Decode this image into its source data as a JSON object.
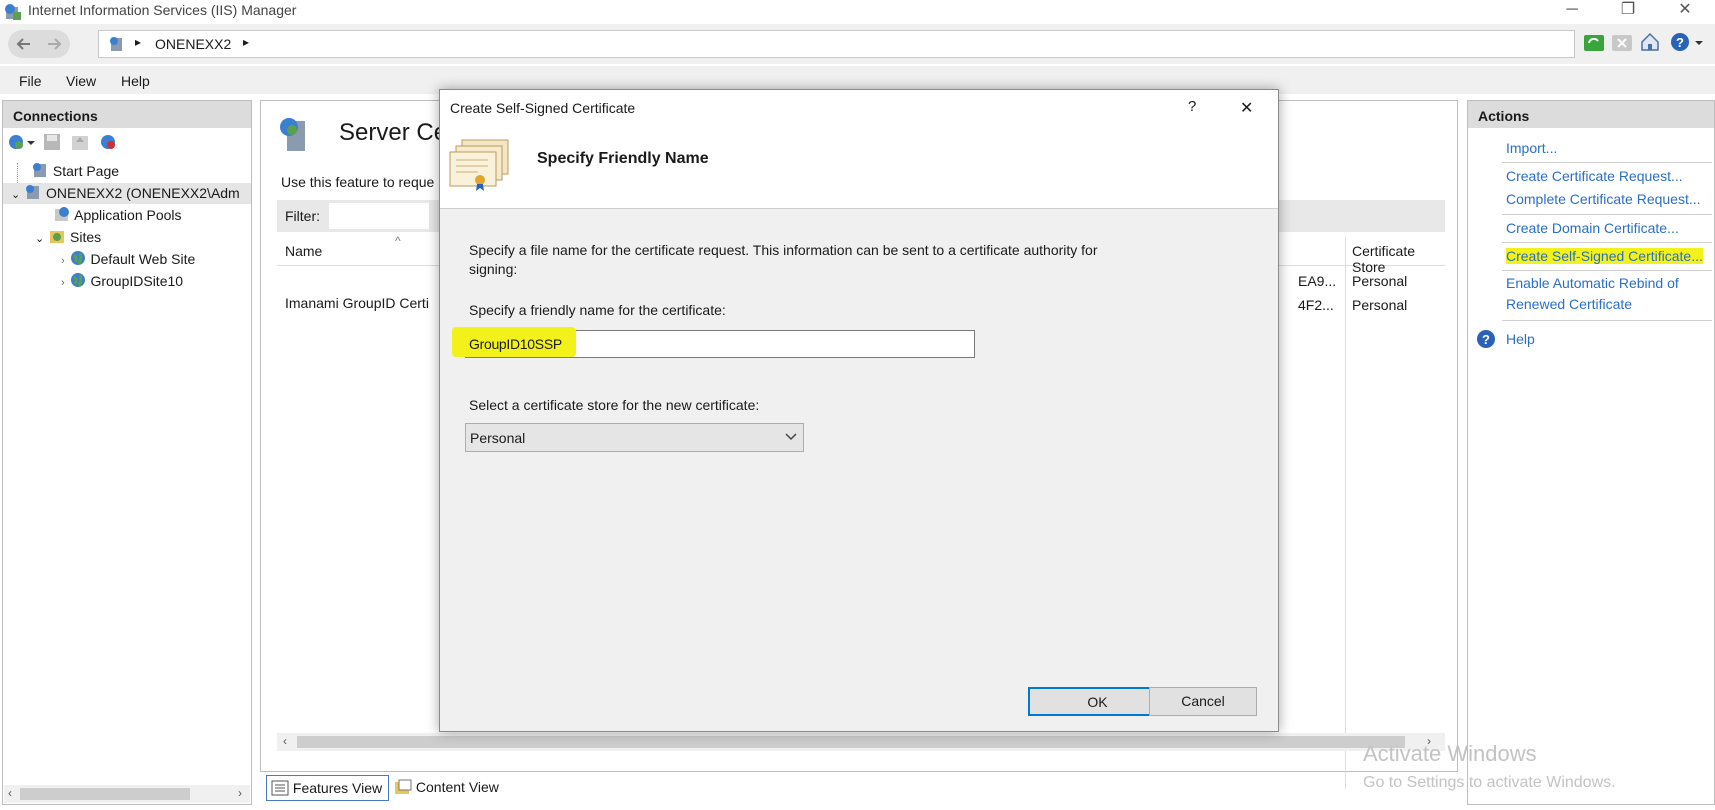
{
  "window": {
    "title": "Internet Information Services (IIS) Manager",
    "controls": {
      "minimize": "─",
      "restore": "❐",
      "close": "✕"
    }
  },
  "address": {
    "path": "ONENEXX2",
    "separator": "▸"
  },
  "menu": {
    "file": "File",
    "view": "View",
    "help": "Help"
  },
  "connections": {
    "header": "Connections",
    "tree": {
      "start_page": "Start Page",
      "server": "ONENEXX2 (ONENEXX2\\Adm",
      "app_pools": "Application Pools",
      "sites": "Sites",
      "default_site": "Default Web Site",
      "groupid_site": "GroupIDSite10"
    }
  },
  "center": {
    "title": "Server Ce",
    "description": "Use this feature to reque",
    "filter_label": "Filter:",
    "columns": {
      "name": "Name",
      "store": "Certificate Store"
    },
    "rows": [
      {
        "name": "Imanami GroupID Certi",
        "hash": "EA9...",
        "store": "Personal"
      },
      {
        "name": "",
        "hash": "4F2...",
        "store": "Personal"
      }
    ],
    "views": {
      "features": "Features View",
      "content": "Content View"
    }
  },
  "actions": {
    "header": "Actions",
    "import": "Import...",
    "create_request": "Create Certificate Request...",
    "complete_request": "Complete Certificate Request...",
    "create_domain": "Create Domain Certificate...",
    "create_self_signed": "Create Self-Signed Certificate...",
    "enable_rebind_1": "Enable Automatic Rebind of",
    "enable_rebind_2": "Renewed Certificate",
    "help": "Help"
  },
  "dialog": {
    "title": "Create Self-Signed Certificate",
    "help_button": "?",
    "close_button": "✕",
    "heading": "Specify Friendly Name",
    "intro_1": "Specify a file name for the certificate request.  This information can be sent to a certificate authority for",
    "intro_2": "signing:",
    "friendly_label": "Specify a friendly name for the certificate:",
    "friendly_value": "GroupID10SSP",
    "store_label": "Select a certificate store for the new certificate:",
    "store_value": "Personal",
    "ok": "OK",
    "cancel": "Cancel"
  },
  "watermark": {
    "line1": "Activate Windows",
    "line2": "Go to Settings to activate Windows."
  },
  "colors": {
    "link": "#2a6fc7",
    "highlight": "#f2f21a",
    "ok_border": "#0078d7"
  }
}
